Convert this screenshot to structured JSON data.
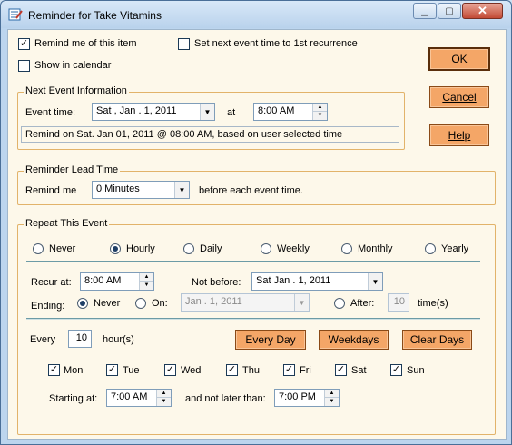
{
  "window": {
    "title": "Reminder for Take Vitamins"
  },
  "top": {
    "remind_label": "Remind me of this item",
    "remind_checked": true,
    "set_next_label": "Set next event time to 1st recurrence",
    "set_next_checked": false,
    "show_calendar_label": "Show in calendar",
    "show_calendar_checked": false
  },
  "buttons": {
    "ok": "OK",
    "cancel": "Cancel",
    "help": "Help"
  },
  "next_event": {
    "group_title": "Next Event Information",
    "event_time_label": "Event time:",
    "date": "Sat ,  Jan .  1, 2011",
    "at_label": "at",
    "time": "8:00 AM",
    "info": "Remind on Sat. Jan 01, 2011 @ 08:00 AM, based on user selected time"
  },
  "lead_time": {
    "group_title": "Reminder Lead Time",
    "remind_me_label": "Remind me",
    "value": "0 Minutes",
    "suffix": "before each event time."
  },
  "repeat": {
    "group_title": "Repeat This Event",
    "options": [
      "Never",
      "Hourly",
      "Daily",
      "Weekly",
      "Monthly",
      "Yearly"
    ],
    "selected": "Hourly",
    "recur_at_label": "Recur at:",
    "recur_at": "8:00 AM",
    "not_before_label": "Not before:",
    "not_before": "Sat   Jan .  1, 2011",
    "ending_label": "Ending:",
    "ending_never": "Never",
    "ending_on": "On:",
    "ending_on_date": "Jan .  1, 2011",
    "ending_after": "After:",
    "after_count": "10",
    "after_suffix": "time(s)",
    "every_label": "Every",
    "every_value": "10",
    "every_unit": "hour(s)",
    "every_day_btn": "Every Day",
    "weekdays_btn": "Weekdays",
    "clear_days_btn": "Clear Days",
    "days": [
      "Mon",
      "Tue",
      "Wed",
      "Thu",
      "Fri",
      "Sat",
      "Sun"
    ],
    "starting_at_label": "Starting at:",
    "starting_at": "7:00 AM",
    "not_later_label": "and not later than:",
    "not_later": "7:00 PM"
  },
  "colors": {
    "accent_button": "#f4a667",
    "group_border": "#e2b36a",
    "panel_bg": "#fdf8ea"
  }
}
